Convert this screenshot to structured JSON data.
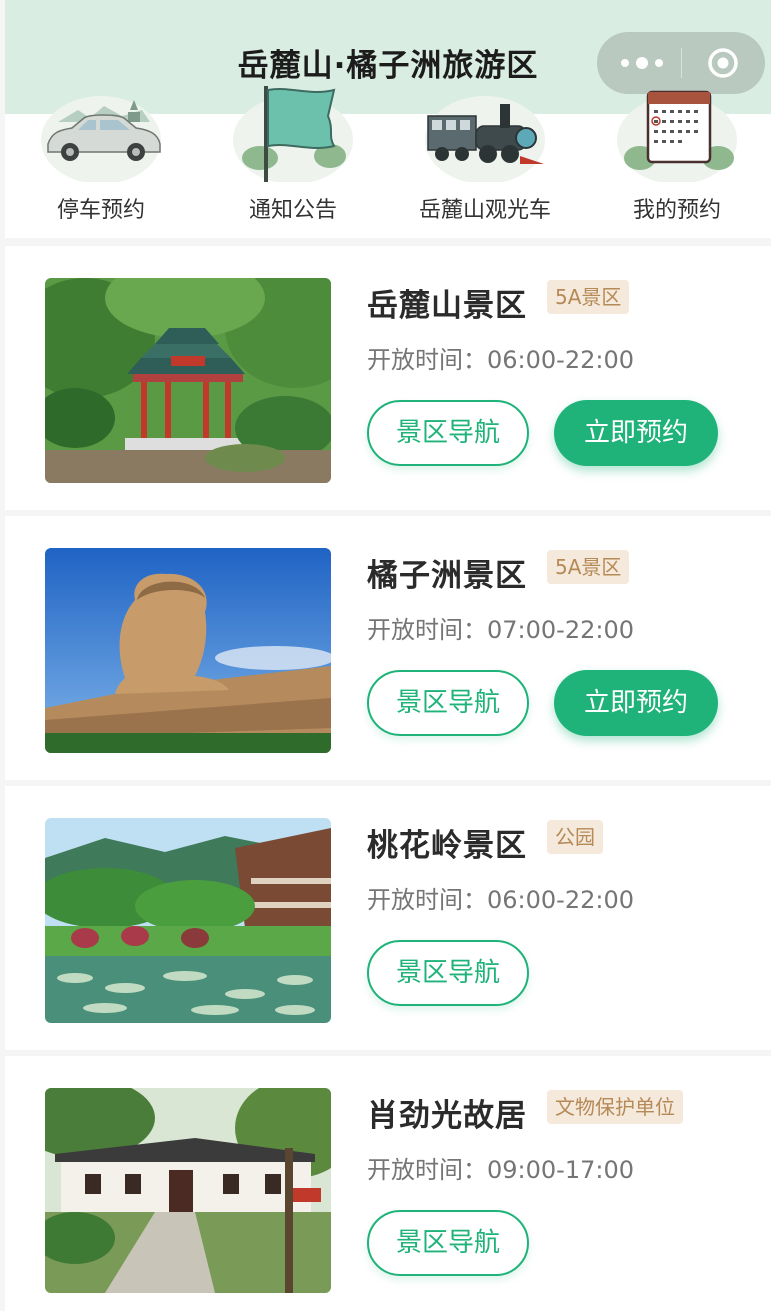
{
  "header": {
    "title": "岳麓山·橘子洲旅游区"
  },
  "capsule": {
    "more_icon": "more-dots-icon",
    "close_icon": "target-icon"
  },
  "quick_links": [
    {
      "label": "停车预约",
      "icon": "car-icon"
    },
    {
      "label": "通知公告",
      "icon": "flag-icon"
    },
    {
      "label": "岳麓山观光车",
      "icon": "train-icon"
    },
    {
      "label": "我的预约",
      "icon": "calendar-icon"
    }
  ],
  "spots": [
    {
      "name": "岳麓山景区",
      "tag": "5A景区",
      "hours": "开放时间：06:00-22:00",
      "nav_label": "景区导航",
      "book_label": "立即预约"
    },
    {
      "name": "橘子洲景区",
      "tag": "5A景区",
      "hours": "开放时间：07:00-22:00",
      "nav_label": "景区导航",
      "book_label": "立即预约"
    },
    {
      "name": "桃花岭景区",
      "tag": "公园",
      "hours": "开放时间：06:00-22:00",
      "nav_label": "景区导航"
    },
    {
      "name": "肖劲光故居",
      "tag": "文物保护单位",
      "hours": "开放时间：09:00-17:00",
      "nav_label": "景区导航"
    }
  ],
  "colors": {
    "accent": "#1fb37a",
    "header_bg": "#d9ede2",
    "tag_bg": "#f5e9dc",
    "tag_text": "#b58a56"
  }
}
